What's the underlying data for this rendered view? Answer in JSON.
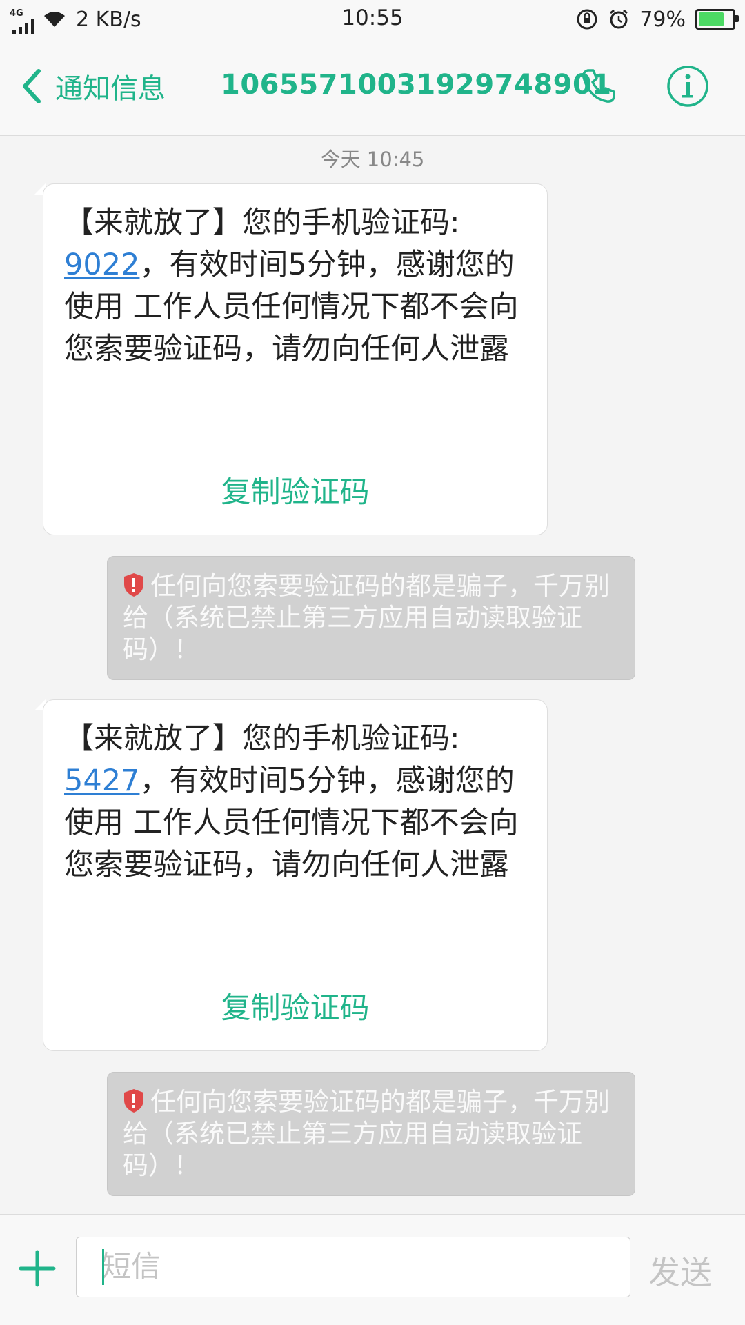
{
  "status_bar": {
    "network": "4G",
    "speed": "2 KB/s",
    "time": "10:55",
    "battery_percent": "79%",
    "battery_level": 0.79,
    "icons": [
      "signal-icon",
      "wifi-icon",
      "rotation-lock-icon",
      "alarm-icon",
      "battery-icon"
    ]
  },
  "header": {
    "back_label": "通知信息",
    "contact": "1065571003192974890​1",
    "icons": [
      "back-chevron-icon",
      "phone-icon",
      "info-icon"
    ]
  },
  "conversation": {
    "timestamp": "今天 10:45",
    "messages": [
      {
        "prefix": "【来就放了】您的手机验证码:",
        "code": "9022",
        "suffix": "，有效时间5分钟，感谢您的使用 工作人员任何情况下都不会向您索要验证码，请勿向任何人泄露",
        "copy_label": "复制验证码"
      },
      {
        "prefix": "【来就放了】您的手机验证码:",
        "code": "5427",
        "suffix": "，有效时间5分钟，感谢您的使用 工作人员任何情况下都不会向您索要验证码，请勿向任何人泄露",
        "copy_label": "复制验证码"
      }
    ],
    "warnings": [
      "任何向您索要验证码的都是骗子，千万别给（系统已禁止第三方应用自动读取验证码）！",
      "任何向您索要验证码的都是骗子，千万别给（系统已禁止第三方应用自动读取验证码）！"
    ]
  },
  "input_bar": {
    "placeholder": "短信",
    "value": "",
    "send_label": "发送"
  },
  "colors": {
    "accent": "#20b48a",
    "link": "#2e7fd4",
    "warning_bg": "#d1d1d1",
    "shield": "#e04848"
  }
}
